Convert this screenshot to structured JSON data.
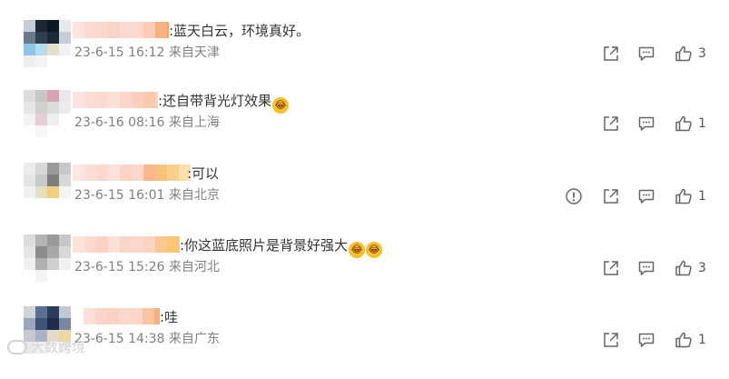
{
  "comments": [
    {
      "text": ":蓝天白云，环境真好。",
      "emojis": [],
      "date": "23-6-15 16:12",
      "location": "来自天津",
      "report": false,
      "likes": "3",
      "avatar": [
        "#c5ccd6",
        "#1b2836",
        "#0e1620",
        "#e8eaee",
        "#6a7a8c",
        "#2f3e50",
        "#1d2a38",
        "#c7cdd6",
        "#8fc6e6",
        "#b4dcef",
        "#e6e0c8",
        "#f2f2f2",
        "#eeeeee",
        "#f4f4f4",
        "#ffffff",
        "#ffffff"
      ],
      "name_colors": [
        "#fde3dc",
        "#fcd9d1",
        "#fdd7cd",
        "#fbd2c8",
        "#fcdad2",
        "#fdd9cf",
        "#fbcdb9",
        "#fbb27a",
        "#f9a84f",
        "#fbc76e",
        "#fdd98f"
      ]
    },
    {
      "text": ":还自带背光灯效果",
      "emojis": [
        "😂"
      ],
      "date": "23-6-16 08:16",
      "location": "来自上海",
      "report": false,
      "likes": "1",
      "avatar": [
        "#dcdcdc",
        "#c8c8c8",
        "#d6a4b2",
        "#e8e8e8",
        "#e6e6e6",
        "#d0d0d0",
        "#dcdcdc",
        "#ececec",
        "#f2f2f2",
        "#e4cfd6",
        "#efefef",
        "#ffffff",
        "#ffffff",
        "#f6f6f6",
        "#ffffff",
        "#ffffff"
      ],
      "name_colors": [
        "#fde4de",
        "#fcdcd5",
        "#fdd9cf",
        "#fde0d6",
        "#fcd6cb",
        "#fbcfbd",
        "#fbc9ad",
        "#fdd6b9",
        "#fbc089",
        "#fab16f",
        "#ffffff"
      ]
    },
    {
      "text": ":可以",
      "emojis": [],
      "date": "23-6-15 16:01",
      "location": "来自北京",
      "report": true,
      "likes": "1",
      "avatar": [
        "#ececec",
        "#d8d8d8",
        "#9a9a9a",
        "#c8c8c8",
        "#e4e4e4",
        "#c9c9c9",
        "#7e7e7e",
        "#d8d8d8",
        "#f0f0f0",
        "#e6e0c2",
        "#f0d080",
        "#f4f4f4",
        "#ffffff",
        "#ffffff",
        "#ffffff",
        "#ffffff"
      ],
      "name_colors": [
        "#fde6e0",
        "#fdded6",
        "#fcd8cd",
        "#fde2da",
        "#fcd3c4",
        "#fcd9cc",
        "#fbb98b",
        "#fac37a",
        "#fbd08d",
        "#fde0ac",
        "#ffffff"
      ]
    },
    {
      "text": ":你这蓝底照片是背景好强大",
      "emojis": [
        "😂",
        "😂"
      ],
      "date": "23-6-15 15:26",
      "location": "来自河北",
      "report": false,
      "likes": "3",
      "avatar": [
        "#dcdcdc",
        "#b4b4b4",
        "#9a9a9a",
        "#c8c8c8",
        "#e6e6e6",
        "#8c8c8c",
        "#a8a8a8",
        "#d8d8d8",
        "#f0f0f0",
        "#b0b0b0",
        "#cfcfcf",
        "#f0f0f0",
        "#ffffff",
        "#f4f4f4",
        "#ffffff",
        "#ffffff"
      ],
      "name_colors": [
        "#fde2da",
        "#fcd8cd",
        "#fdd2c5",
        "#fde0d6",
        "#fbd4c8",
        "#fcd7cb",
        "#fdd4c0",
        "#fbc78e",
        "#fbc573",
        "#fdd089",
        "#fdd9a0"
      ]
    },
    {
      "text": ":哇",
      "emojis": [],
      "date": "23-6-15 14:38",
      "location": "来自广东",
      "report": false,
      "likes": "1",
      "avatar": [
        "#d0d4dc",
        "#5a7090",
        "#2c3c5a",
        "#c0c8d4",
        "#9aa6ba",
        "#3e5478",
        "#1e2c48",
        "#7888a4",
        "#c8c8d0",
        "#a8b2c8",
        "#e4dcc8",
        "#f0d8a0",
        "#e8e8ec",
        "#f0f0f0",
        "#fafafa",
        "#f4f4f4"
      ],
      "name_colors": [
        "#fde0d8",
        "#fcd4c9",
        "#fbd1c4",
        "#fcd8cc",
        "#fdd6c8",
        "#fbc4a0",
        "#f8b075",
        "#ffffff",
        "#ffffff",
        "#ffffff",
        "#ffffff"
      ]
    }
  ],
  "icons": {
    "share": "share-icon",
    "reply": "comment-icon",
    "like": "thumbs-up-icon",
    "report": "report-icon"
  },
  "watermark": {
    "text": "大数跨境"
  }
}
